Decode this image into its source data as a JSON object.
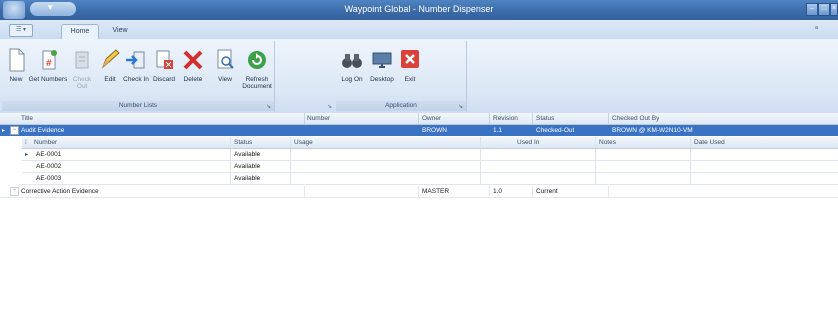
{
  "window": {
    "title": "Waypoint Global - Number Dispenser"
  },
  "tabs": [
    {
      "label": "Home"
    },
    {
      "label": "View"
    }
  ],
  "ribbon": {
    "groups": [
      {
        "label": "Number Lists"
      },
      {
        "label": ""
      },
      {
        "label": "Application"
      }
    ],
    "buttons": {
      "new": "New",
      "get_numbers": "Get Numbers",
      "check_out": "Check Out",
      "edit": "Edit",
      "check_in": "Check In",
      "discard": "Discard",
      "delete": "Delete",
      "view": "View",
      "refresh": "Refresh Document",
      "log_on": "Log On",
      "desktop": "Desktop",
      "exit": "Exit"
    }
  },
  "grid": {
    "columns": [
      "Title",
      "Number",
      "Owner",
      "Revision",
      "Status",
      "Checked Out By"
    ],
    "rows": [
      {
        "title": "Audit Evidence",
        "number": "",
        "owner": "BROWN",
        "revision": "1.1",
        "status": "Checked-Out",
        "checked_out_by": "BROWN @ KM-W2N10-VM"
      },
      {
        "title": "Corrective Action Evidence",
        "number": "",
        "owner": "MASTER",
        "revision": "1.0",
        "status": "Current",
        "checked_out_by": ""
      }
    ],
    "sub_columns": [
      "Number",
      "Status",
      "Usage",
      "Used In",
      "Notes",
      "Date Used"
    ],
    "sub_rows": [
      {
        "number": "AE-0001",
        "status": "Available",
        "usage": "",
        "used_in": "",
        "notes": "",
        "date_used": ""
      },
      {
        "number": "AE-0002",
        "status": "Available",
        "usage": "",
        "used_in": "",
        "notes": "",
        "date_used": ""
      },
      {
        "number": "AE-0003",
        "status": "Available",
        "usage": "",
        "used_in": "",
        "notes": "",
        "date_used": ""
      }
    ]
  },
  "colors": {
    "title_bar": "#3a6aa8",
    "selected_row": "#3a73c4",
    "ribbon": "#dbe7f5"
  }
}
